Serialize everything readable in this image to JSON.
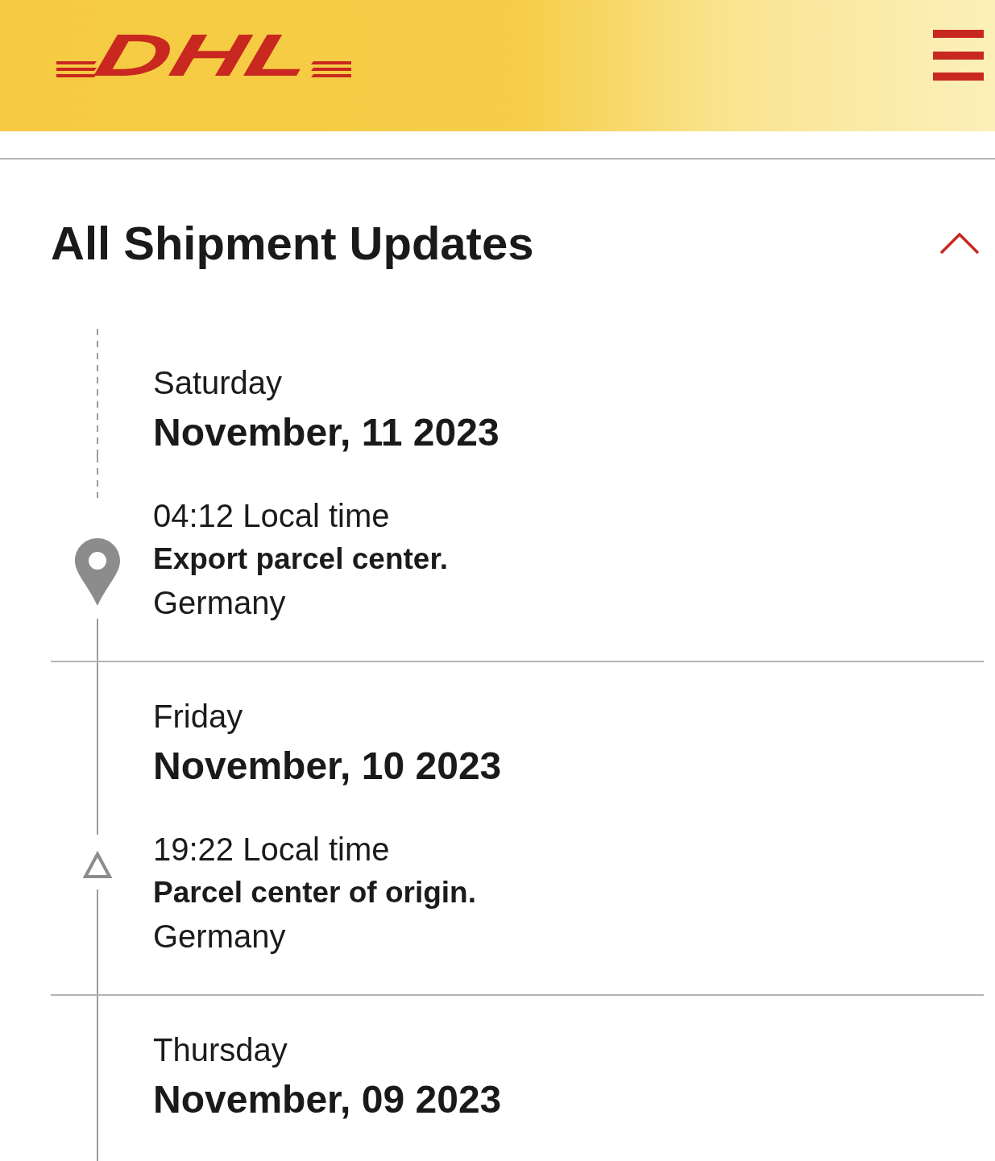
{
  "header": {
    "logo": "DHL"
  },
  "section": {
    "title": "All Shipment Updates",
    "expanded": true
  },
  "days": [
    {
      "weekday": "Saturday",
      "date": "November, 11 2023",
      "events": [
        {
          "kind": "latest",
          "time": "04:12 Local time",
          "description": "Export parcel center.",
          "location": "Germany"
        }
      ]
    },
    {
      "weekday": "Friday",
      "date": "November, 10 2023",
      "events": [
        {
          "kind": "checkpoint",
          "time": "19:22 Local time",
          "description": "Parcel center of origin.",
          "location": "Germany"
        }
      ]
    },
    {
      "weekday": "Thursday",
      "date": "November, 09 2023"
    }
  ]
}
